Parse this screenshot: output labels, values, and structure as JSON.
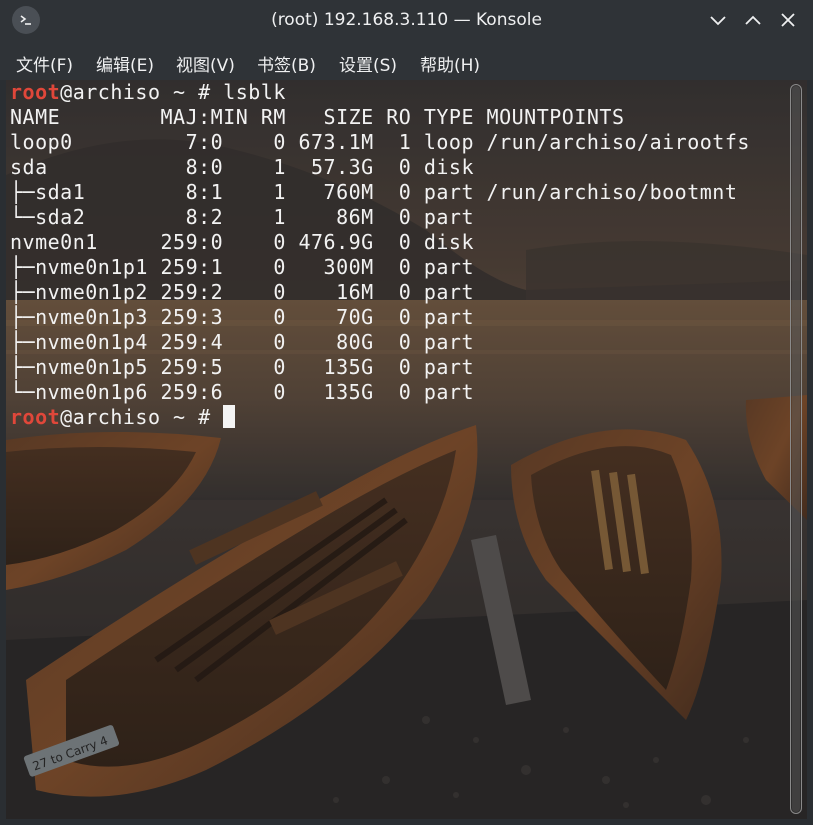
{
  "window": {
    "title": "(root) 192.168.3.110 — Konsole",
    "icons": {
      "app": "terminal-prompt-icon",
      "minimize": "chevron-down-icon",
      "maximize": "chevron-up-icon",
      "close": "close-icon"
    }
  },
  "menubar": {
    "items": [
      {
        "label": "文件(F)"
      },
      {
        "label": "编辑(E)"
      },
      {
        "label": "视图(V)"
      },
      {
        "label": "书签(B)"
      },
      {
        "label": "设置(S)"
      },
      {
        "label": "帮助(H)"
      }
    ]
  },
  "terminal": {
    "prompt_user": "root",
    "prompt_rest": "@archiso ~ # ",
    "command": "lsblk",
    "output_lines": [
      "NAME        MAJ:MIN RM   SIZE RO TYPE MOUNTPOINTS",
      "loop0         7:0    0 673.1M  1 loop /run/archiso/airootfs",
      "sda           8:0    1  57.3G  0 disk",
      "├─sda1        8:1    1   760M  0 part /run/archiso/bootmnt",
      "└─sda2        8:2    1    86M  0 part",
      "nvme0n1     259:0    0 476.9G  0 disk",
      "├─nvme0n1p1 259:1    0   300M  0 part",
      "├─nvme0n1p2 259:2    0    16M  0 part",
      "├─nvme0n1p3 259:3    0    70G  0 part",
      "├─nvme0n1p4 259:4    0    80G  0 part",
      "├─nvme0n1p5 259:5    0   135G  0 part",
      "└─nvme0n1p6 259:6    0   135G  0 part"
    ],
    "background_sign_text": "27 to Carry 4",
    "colors": {
      "foreground": "#f2f2f2",
      "prompt_user": "#e0473a",
      "cursor": "#f4f4f4"
    }
  }
}
